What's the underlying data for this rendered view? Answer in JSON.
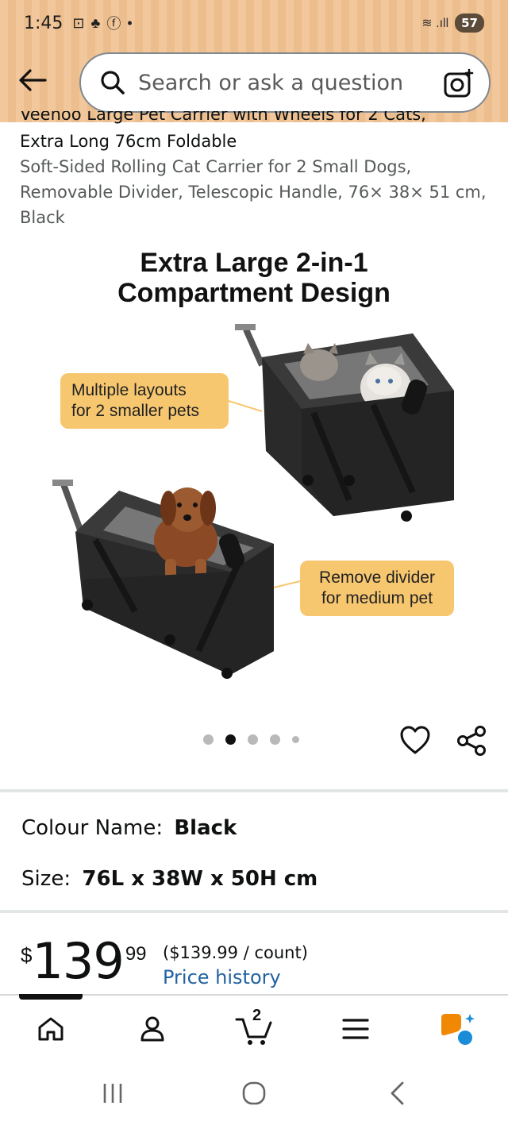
{
  "status": {
    "time": "1:45",
    "battery": "57"
  },
  "search": {
    "placeholder": "Search or ask a question"
  },
  "product": {
    "title_line1": "Veenoo Large Pet Carrier with Wheels for 2 Cats,",
    "title_line2": "Extra Long 76cm Foldable",
    "title_rest": "Soft-Sided Rolling Cat Carrier for 2 Small Dogs, Removable Divider, Telescopic Handle, 76× 38× 51 cm, Black"
  },
  "hero": {
    "heading_line1": "Extra Large 2-in-1",
    "heading_line2": "Compartment Design",
    "callout1_line1": "Multiple layouts",
    "callout1_line2": "for 2 smaller pets",
    "callout2_line1": "Remove divider",
    "callout2_line2": "for medium pet"
  },
  "carousel": {
    "count": 5,
    "active_index": 1
  },
  "variants": {
    "colour_label": "Colour Name:",
    "colour_value": "Black",
    "size_label": "Size:",
    "size_value": "76L x 38W x 50H cm"
  },
  "price": {
    "currency": "$",
    "whole": "139",
    "fraction": "99",
    "unit_price": "($139.99 / count)",
    "history_link": "Price history"
  },
  "bottom_nav": {
    "cart_count": "2",
    "items": [
      "home-icon",
      "account-icon",
      "cart-icon",
      "menu-icon",
      "rufus-icon"
    ]
  },
  "colors": {
    "header_bg": "#f1c79b",
    "link": "#2162a1",
    "callout": "#f7c770",
    "rufus_orange": "#f08804",
    "rufus_blue": "#1a8cd8"
  }
}
